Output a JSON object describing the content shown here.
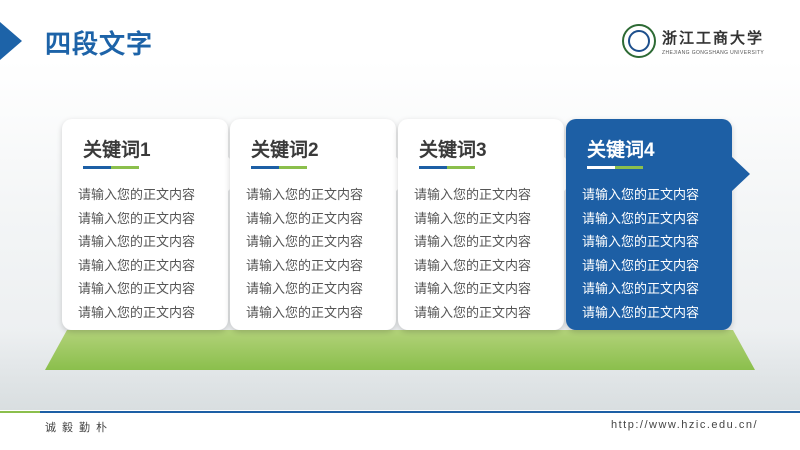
{
  "header": {
    "title": "四段文字",
    "logo": {
      "name_cn": "浙江工商大学",
      "name_en": "ZHEJIANG GONGSHANG UNIVERSITY"
    }
  },
  "cards": [
    {
      "title": "关键词1",
      "lines": [
        "请输入您的正文内容",
        "请输入您的正文内容",
        "请输入您的正文内容",
        "请输入您的正文内容",
        "请输入您的正文内容",
        "请输入您的正文内容"
      ]
    },
    {
      "title": "关键词2",
      "lines": [
        "请输入您的正文内容",
        "请输入您的正文内容",
        "请输入您的正文内容",
        "请输入您的正文内容",
        "请输入您的正文内容",
        "请输入您的正文内容"
      ]
    },
    {
      "title": "关键词3",
      "lines": [
        "请输入您的正文内容",
        "请输入您的正文内容",
        "请输入您的正文内容",
        "请输入您的正文内容",
        "请输入您的正文内容",
        "请输入您的正文内容"
      ]
    },
    {
      "title": "关键词4",
      "lines": [
        "请输入您的正文内容",
        "请输入您的正文内容",
        "请输入您的正文内容",
        "请输入您的正文内容",
        "请输入您的正文内容",
        "请输入您的正文内容"
      ]
    }
  ],
  "footer": {
    "motto": "诚毅勤朴",
    "url": "http://www.hzic.edu.cn/"
  },
  "colors": {
    "primary_blue": "#1d5fa5",
    "accent_green": "#8bbf4c"
  }
}
